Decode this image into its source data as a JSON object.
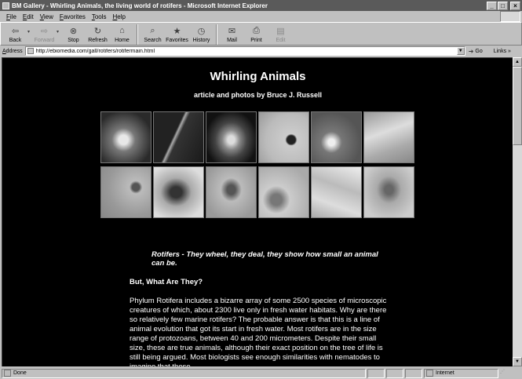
{
  "window": {
    "title": "BM Gallery - Whirling Animals, the living world of rotifers - Microsoft Internet Explorer",
    "controls": [
      "_",
      "□",
      "×"
    ]
  },
  "menu": [
    "File",
    "Edit",
    "View",
    "Favorites",
    "Tools",
    "Help"
  ],
  "toolbar": {
    "buttons": [
      {
        "label": "Back",
        "icon": "back-arrow-icon",
        "glyph": "⇦",
        "disabled": false
      },
      {
        "label": "Forward",
        "icon": "forward-arrow-icon",
        "glyph": "⇨",
        "disabled": true
      },
      {
        "label": "Stop",
        "icon": "stop-icon",
        "glyph": "⊗",
        "disabled": false
      },
      {
        "label": "Refresh",
        "icon": "refresh-icon",
        "glyph": "↻",
        "disabled": false
      },
      {
        "label": "Home",
        "icon": "home-icon",
        "glyph": "⌂",
        "disabled": false
      },
      {
        "label": "Search",
        "icon": "search-icon",
        "glyph": "⌕",
        "disabled": false
      },
      {
        "label": "Favorites",
        "icon": "favorites-icon",
        "glyph": "★",
        "disabled": false
      },
      {
        "label": "History",
        "icon": "history-icon",
        "glyph": "◷",
        "disabled": false
      },
      {
        "label": "Mail",
        "icon": "mail-icon",
        "glyph": "✉",
        "disabled": false
      },
      {
        "label": "Print",
        "icon": "print-icon",
        "glyph": "⎙",
        "disabled": false
      },
      {
        "label": "Edit",
        "icon": "edit-icon",
        "glyph": "▤",
        "disabled": true
      }
    ]
  },
  "address": {
    "label": "Address",
    "url": "http://ebiomedia.com/gall/rotifers/rotifermain.html",
    "go_label": "Go",
    "links_label": "Links »"
  },
  "page": {
    "title": "Whirling Animals",
    "byline": "article and photos by Bruce J. Russell",
    "gallery_rows": [
      6,
      6
    ],
    "tagline": "Rotifers - They wheel, they deal, they show how small an animal can be.",
    "section_heading": "But, What Are They?",
    "body": "Phylum Rotifera includes a bizarre array of some 2500 species of microscopic creatures of which, about 2300 live only in fresh water habitats. Why are there so relatively few marine rotifers? The probable answer is that this is a line of animal evolution that got its start in fresh water. Most rotifers are in the size range of protozoans, between 40 and 200 micrometers. Despite their small size, these are true animals, although their exact position on the tree of life is still being argued. Most biologists see enough similarities with nematodes to imagine that these"
  },
  "status": {
    "text": "Done",
    "zone": "Internet"
  }
}
